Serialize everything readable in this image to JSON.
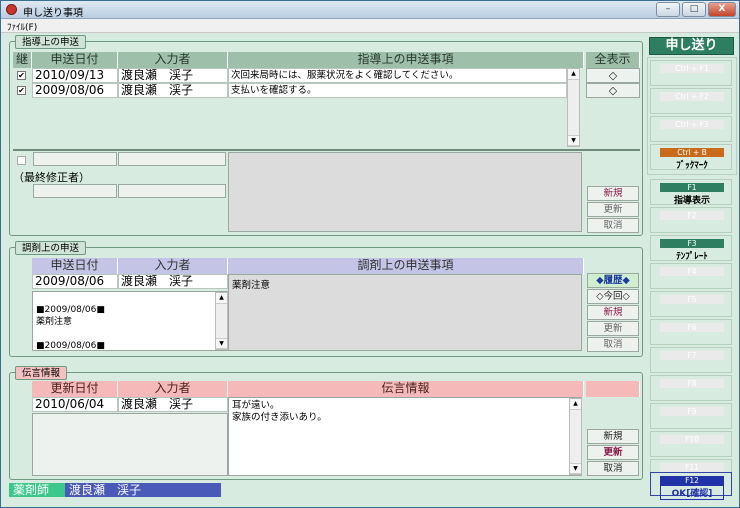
{
  "window": {
    "title": "申し送り事項",
    "min_label": "–",
    "max_label": "□",
    "close_label": "X"
  },
  "menu": {
    "file": "ﾌｧｲﾙ(F)"
  },
  "guidance": {
    "section_label": "指導上の申送",
    "headers": {
      "flag": "継",
      "date": "申送日付",
      "author": "入力者",
      "content": "指導上の申送事項",
      "show_all": "全表示"
    },
    "rows": [
      {
        "checked": true,
        "date": "2010/09/13",
        "author": "渡良瀬　渓子",
        "content": "次回来局時には、服薬状況をよく確認してください。",
        "mark": "◇"
      },
      {
        "checked": true,
        "date": "2009/08/06",
        "author": "渡良瀬　渓子",
        "content": "支払いを確認する。",
        "mark": "◇"
      }
    ],
    "last_editor_label": "（最終修正者）",
    "buttons": {
      "new": "新規",
      "update": "更新",
      "cancel": "取消"
    }
  },
  "dispensing": {
    "section_label": "調剤上の申送",
    "headers": {
      "date": "申送日付",
      "author": "入力者",
      "content": "調剤上の申送事項"
    },
    "row": {
      "date": "2009/08/06",
      "author": "渡良瀬　渓子",
      "content": "薬剤注意"
    },
    "history_lines": [
      "■2009/08/06■",
      "薬剤注意",
      "",
      "■2009/08/06■"
    ],
    "buttons": {
      "history": "◆履歴◆",
      "current": "◇今回◇",
      "new": "新規",
      "update": "更新",
      "cancel": "取消"
    }
  },
  "message": {
    "section_label": "伝言情報",
    "headers": {
      "date": "更新日付",
      "author": "入力者",
      "content": "伝言情報"
    },
    "row": {
      "date": "2010/06/04",
      "author": "渡良瀬　渓子"
    },
    "content_lines": [
      "耳が遠い。",
      "家族の付き添いあり。"
    ],
    "buttons": {
      "new": "新規",
      "update": "更新",
      "cancel": "取消"
    }
  },
  "status": {
    "role": "薬剤師",
    "user": "渡良瀬　渓子"
  },
  "sidebar": {
    "title": "申し送り",
    "keys": [
      {
        "cap": "Ctrl + F1",
        "label": "",
        "style": "plain"
      },
      {
        "cap": "Ctrl + F2",
        "label": "",
        "style": "plain"
      },
      {
        "cap": "Ctrl + F3",
        "label": "",
        "style": "plain"
      },
      {
        "cap": "Ctrl + B",
        "label": "ﾌﾞｯｸﾏｰｸ",
        "style": "orange"
      },
      {
        "cap": "F1",
        "label": "指導表示",
        "style": "green"
      },
      {
        "cap": "F2",
        "label": "",
        "style": "plain"
      },
      {
        "cap": "F3",
        "label": "ﾃﾝﾌﾟﾚｰﾄ",
        "style": "green"
      },
      {
        "cap": "F4",
        "label": "",
        "style": "plain"
      },
      {
        "cap": "F5",
        "label": "",
        "style": "plain"
      },
      {
        "cap": "F6",
        "label": "",
        "style": "plain"
      },
      {
        "cap": "F7",
        "label": "",
        "style": "plain"
      },
      {
        "cap": "F8",
        "label": "",
        "style": "plain"
      },
      {
        "cap": "F9",
        "label": "",
        "style": "plain"
      },
      {
        "cap": "F10",
        "label": "",
        "style": "plain"
      },
      {
        "cap": "F11",
        "label": "",
        "style": "plain"
      },
      {
        "cap": "F12",
        "label": "OK[確認]",
        "style": "blue"
      }
    ]
  },
  "colors": {
    "panel_bg": "#d8ebe0",
    "header_green": "#9ebfa9",
    "header_blue": "#c3c4e6",
    "header_pink": "#f5b9b9",
    "sidebar_title": "#2e7e62"
  }
}
